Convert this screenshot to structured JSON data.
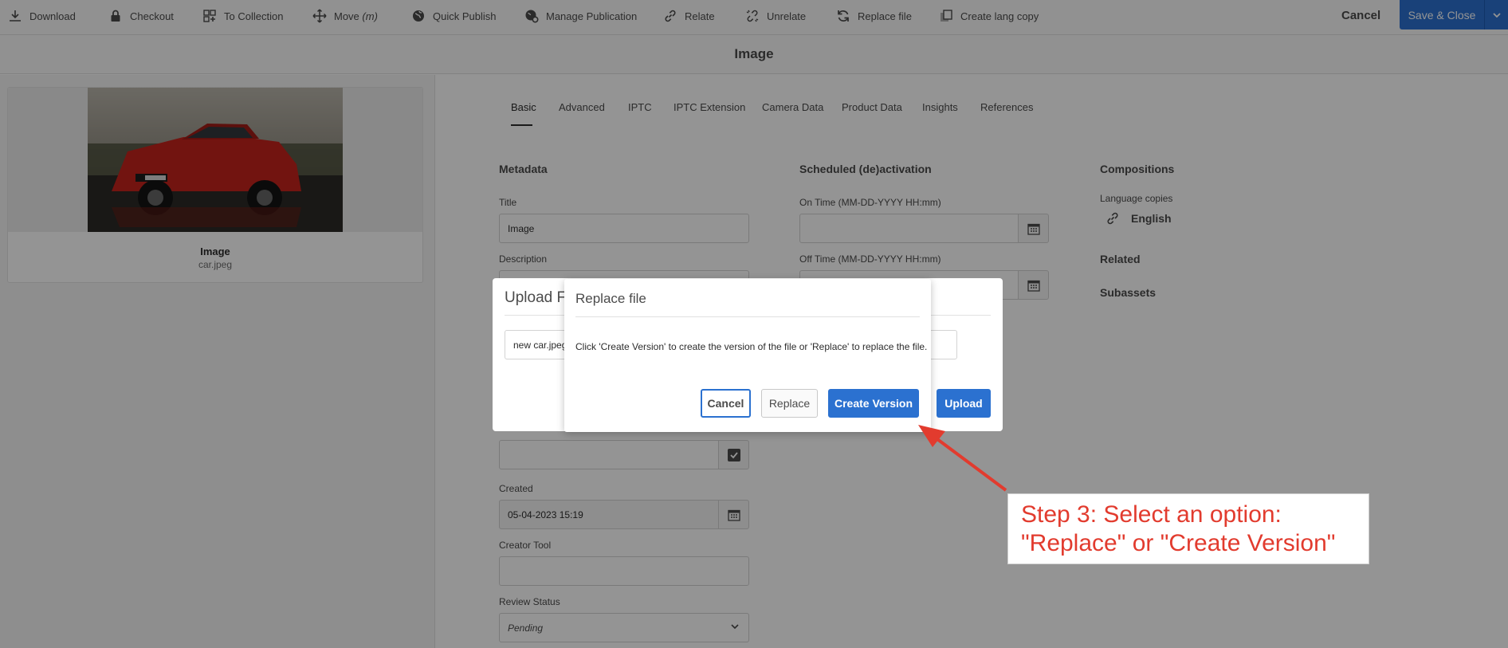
{
  "toolbar": {
    "items": [
      {
        "label": "Download",
        "icon": "download-icon"
      },
      {
        "label": "Checkout",
        "icon": "lock-icon"
      },
      {
        "label": "To Collection",
        "icon": "collection-icon"
      },
      {
        "label": "Move ",
        "hint": "(m)",
        "icon": "move-icon"
      },
      {
        "label": "Quick Publish",
        "icon": "globe-icon"
      },
      {
        "label": "Manage Publication",
        "icon": "globe-gear-icon"
      },
      {
        "label": "Relate",
        "icon": "link-icon"
      },
      {
        "label": "Unrelate",
        "icon": "unlink-icon"
      },
      {
        "label": "Replace file",
        "icon": "refresh-icon"
      },
      {
        "label": "Create lang copy",
        "icon": "copy-icon"
      }
    ],
    "cancel": "Cancel",
    "save_close": "Save & Close"
  },
  "page": {
    "title": "Image"
  },
  "asset": {
    "name": "Image",
    "file": "car.jpeg"
  },
  "tabs": [
    "Basic",
    "Advanced",
    "IPTC",
    "IPTC Extension",
    "Camera Data",
    "Product Data",
    "Insights",
    "References"
  ],
  "active_tab": "Basic",
  "metadata": {
    "heading": "Metadata",
    "title_label": "Title",
    "title_value": "Image",
    "description_label": "Description",
    "created_label": "Created",
    "created_value": "05-04-2023 15:19",
    "creator_tool_label": "Creator Tool",
    "review_status_label": "Review Status",
    "review_status_value": "Pending"
  },
  "scheduled": {
    "heading": "Scheduled (de)activation",
    "on_time_label": "On Time (MM-DD-YYYY HH:mm)",
    "off_time_label": "Off Time (MM-DD-YYYY HH:mm)"
  },
  "right": {
    "compositions": "Compositions",
    "language_copies": "Language copies",
    "english": "English",
    "related": "Related",
    "subassets": "Subassets"
  },
  "upload_dialog": {
    "title_visible": "Upload Fi",
    "file_value": "new car.jpeg",
    "upload_button": "Upload"
  },
  "replace_dialog": {
    "title": "Replace file",
    "message": "Click 'Create Version' to create the version of the file or 'Replace' to replace the file.",
    "cancel": "Cancel",
    "replace": "Replace",
    "create_version": "Create Version"
  },
  "annotation": {
    "line1": "Step 3: Select an option:",
    "line2": "\"Replace\" or \"Create Version\"",
    "color": "#e23b2e"
  },
  "colors": {
    "accent": "#2b71d0"
  }
}
